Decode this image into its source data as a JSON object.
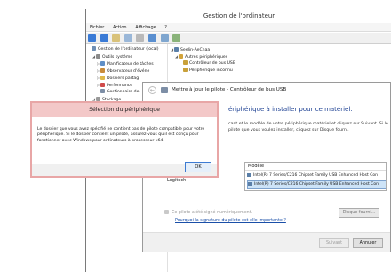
{
  "computer_management": {
    "title": "Gestion de l'ordinateur",
    "menu": [
      "Fichier",
      "Action",
      "Affichage",
      "?"
    ],
    "tree": [
      {
        "label": "Gestion de l'ordinateur (local)",
        "icon": "computer-management-icon",
        "indent": 0,
        "expander": ""
      },
      {
        "label": "Outils système",
        "icon": "tools-icon",
        "indent": 1,
        "expander": "◢"
      },
      {
        "label": "Planificateur de tâches",
        "icon": "clock-icon",
        "indent": 2,
        "expander": "▷"
      },
      {
        "label": "Observateur d'événe",
        "icon": "event-viewer-icon",
        "indent": 2,
        "expander": "▷"
      },
      {
        "label": "Dossiers partag",
        "icon": "folder-icon",
        "indent": 2,
        "expander": "▷"
      },
      {
        "label": "Performance",
        "icon": "performance-icon",
        "indent": 2,
        "expander": "▷"
      },
      {
        "label": "Gestionnaire de",
        "icon": "device-manager-icon",
        "indent": 2,
        "expander": ""
      },
      {
        "label": "Stockage",
        "icon": "storage-icon",
        "indent": 1,
        "expander": "◢"
      },
      {
        "label": "Gestion des disq",
        "icon": "disk-icon",
        "indent": 2,
        "expander": ""
      },
      {
        "label": "Services et applicat",
        "icon": "services-icon",
        "indent": 1,
        "expander": "▷"
      }
    ],
    "devices": [
      {
        "label": "Seelin-AeChaa",
        "icon": "computer-icon",
        "indent": 0,
        "expander": "◢"
      },
      {
        "label": "Autres périphériques",
        "icon": "warning-device-icon",
        "indent": 1,
        "expander": "◢"
      },
      {
        "label": "Contrôleur de bus USB",
        "icon": "usb-device-icon",
        "indent": 2,
        "expander": ""
      },
      {
        "label": "Périphérique inconnu",
        "icon": "unknown-device-icon",
        "indent": 2,
        "expander": ""
      }
    ]
  },
  "update_driver": {
    "title": "Mettre à jour le pilote - Contrôleur de bus USB",
    "heading": "ériphérique à installer pour ce matériel.",
    "description": "cant et le modèle de votre périphérique matériel et cliquez sur Suivant. Si le pilote que vous voulez installer, cliquez sur Disque fourni.",
    "manufacturer_item": "Logitech",
    "model_header": "Modèle",
    "models": [
      {
        "label": "Intel(R) 7 Series/C216 Chipset Family USB Enhanced Host Con",
        "selected": false
      },
      {
        "label": "Intel(R) 7 Series/C216 Chipset Family USB Enhanced Host Con",
        "selected": true
      }
    ],
    "signature_status": "Ce pilote a été signé numériquement.",
    "signature_link": "Pourquoi la signature du pilote est-elle importante ?",
    "disk_button": "Disque fourni...",
    "next_button": "Suivant",
    "cancel_button": "Annuler"
  },
  "device_selection": {
    "title": "Sélection du périphérique",
    "message": "Le dossier que vous avez spécifié ne contient pas de pilote compatible pour votre périphérique. Si le dossier contient un pilote, assurez-vous qu'il est conçu pour fonctionner avec Windows pour ordinateurs à processeur x64.",
    "ok_button": "OK"
  },
  "colors": {
    "dialog_title_bg": "#f3c8c8",
    "dialog_border": "#e8a6a6",
    "wizard_heading": "#1b3f92",
    "link": "#1a4fa8",
    "selection": "#cde3f7"
  }
}
